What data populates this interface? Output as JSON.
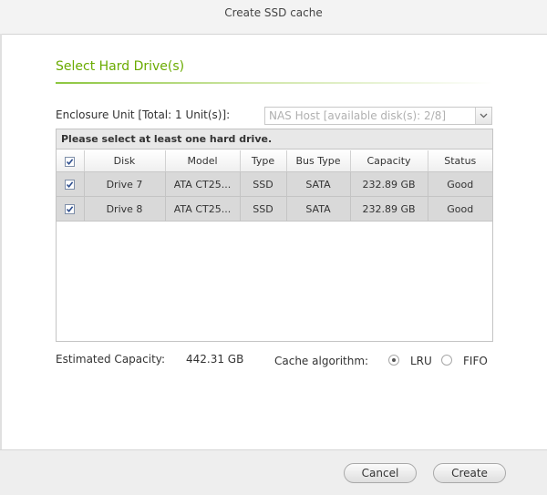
{
  "window": {
    "title": "Create SSD cache"
  },
  "section": {
    "title": "Select Hard Drive(s)"
  },
  "enclosure": {
    "label": "Enclosure Unit [Total: 1 Unit(s)]:",
    "selected": "NAS Host [available disk(s): 2/8]"
  },
  "table": {
    "hint": "Please select at least one hard drive.",
    "columns": [
      "Disk",
      "Model",
      "Type",
      "Bus Type",
      "Capacity",
      "Status"
    ],
    "select_all_checked": true,
    "rows": [
      {
        "checked": true,
        "disk": "Drive 7",
        "model": "ATA CT25...",
        "type": "SSD",
        "bus": "SATA",
        "capacity": "232.89 GB",
        "status": "Good"
      },
      {
        "checked": true,
        "disk": "Drive 8",
        "model": "ATA CT25...",
        "type": "SSD",
        "bus": "SATA",
        "capacity": "232.89 GB",
        "status": "Good"
      }
    ]
  },
  "estimate": {
    "label": "Estimated Capacity:",
    "value": "442.31 GB"
  },
  "cache": {
    "label": "Cache algorithm:",
    "options": [
      {
        "label": "LRU",
        "selected": true
      },
      {
        "label": "FIFO",
        "selected": false
      }
    ]
  },
  "buttons": {
    "cancel": "Cancel",
    "create": "Create"
  },
  "colors": {
    "accent": "#6aab00",
    "row_bg": "#d9d9d9",
    "checkbox_mark": "#2f4f8f"
  },
  "icons": {
    "dropdown": "chevron-down-icon",
    "checkbox": "checkmark-icon"
  }
}
